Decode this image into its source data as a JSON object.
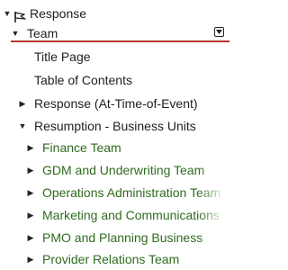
{
  "tree": {
    "root": {
      "label": "Response",
      "icon": "flag-icon",
      "expanded": true
    },
    "team": {
      "label": "Team",
      "expanded": true,
      "selected": true,
      "menu_icon": "dropdown-menu-icon"
    },
    "items": [
      {
        "label": "Title Page"
      },
      {
        "label": "Table of Contents"
      },
      {
        "label": "Response (At-Time-of-Event)",
        "expanded": false
      },
      {
        "label": "Resumption - Business Units",
        "expanded": true
      }
    ],
    "business_units": [
      {
        "label": "Finance Team"
      },
      {
        "label": "GDM and Underwriting Team"
      },
      {
        "label": "Operations Administration Team"
      },
      {
        "label": "Marketing and Communications"
      },
      {
        "label": "PMO and Planning Business"
      },
      {
        "label": "Provider Relations Team"
      }
    ]
  },
  "colors": {
    "text": "#1f1f1f",
    "green_text": "#2f6b1f",
    "selection_underline": "#b5352c"
  }
}
